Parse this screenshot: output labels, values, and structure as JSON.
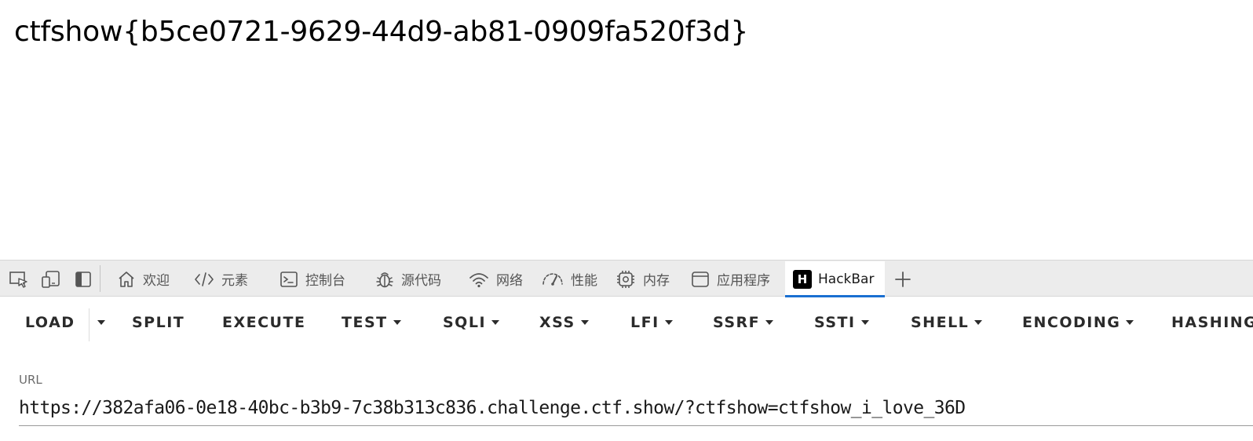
{
  "page": {
    "flag": "ctfshow{b5ce0721-9629-44d9-ab81-0909fa520f3d}"
  },
  "devtools": {
    "tools": [
      {
        "icon": "inspect-element-icon"
      },
      {
        "icon": "device-emulation-icon"
      },
      {
        "icon": "sidebar-toggle-icon"
      }
    ],
    "tabs": [
      {
        "label": "欢迎",
        "icon": "home-icon"
      },
      {
        "label": "元素",
        "icon": "code-icon"
      },
      {
        "label": "控制台",
        "icon": "console-icon"
      },
      {
        "label": "源代码",
        "icon": "bug-icon"
      },
      {
        "label": "网络",
        "icon": "wifi-icon"
      },
      {
        "label": "性能",
        "icon": "gauge-icon"
      },
      {
        "label": "内存",
        "icon": "chip-icon"
      },
      {
        "label": "应用程序",
        "icon": "window-icon"
      },
      {
        "label": "HackBar",
        "icon": "hackbar-logo-icon",
        "logo_letter": "H",
        "active": true
      }
    ],
    "add_tab_icon": "plus-icon",
    "accent_color": "#1a6fd1"
  },
  "hackbar": {
    "toolbar": {
      "load": "LOAD",
      "split": "SPLIT",
      "execute": "EXECUTE",
      "test": "TEST",
      "sqli": "SQLI",
      "xss": "XSS",
      "lfi": "LFI",
      "ssrf": "SSRF",
      "ssti": "SSTI",
      "shell": "SHELL",
      "encoding": "ENCODING",
      "hashing": "HASHING"
    },
    "url_label": "URL",
    "url_value": "https://382afa06-0e18-40bc-b3b9-7c38b313c836.challenge.ctf.show/?ctfshow=ctfshow_i_love_36D"
  }
}
